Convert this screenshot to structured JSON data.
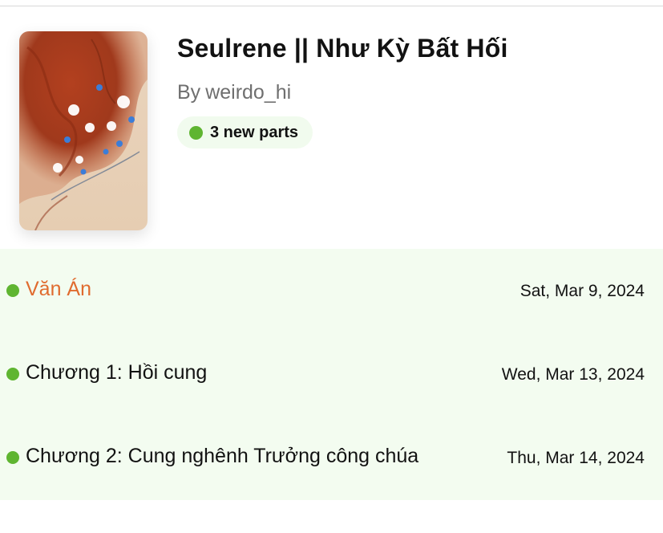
{
  "story": {
    "title": "Seulrene || Như Kỳ Bất Hối",
    "author_prefix": "By",
    "author": "weirdo_hi",
    "new_parts_label": "3 new parts",
    "cover_description": "cover-art"
  },
  "parts": [
    {
      "title": "Văn Án",
      "date": "Sat, Mar 9, 2024",
      "is_new": true,
      "title_color": "#e06b2e"
    },
    {
      "title": "Chương 1: Hồi cung",
      "date": "Wed, Mar 13, 2024",
      "is_new": true,
      "title_color": "#121212"
    },
    {
      "title": "Chương 2: Cung nghênh Trưởng công chúa",
      "date": "Thu, Mar 14, 2024",
      "is_new": true,
      "title_color": "#121212"
    }
  ],
  "colors": {
    "new_dot": "#5fb531",
    "badge_bg": "#f1fbee",
    "parts_bg": "#f3fcf0",
    "highlight_title": "#e06b2e"
  }
}
